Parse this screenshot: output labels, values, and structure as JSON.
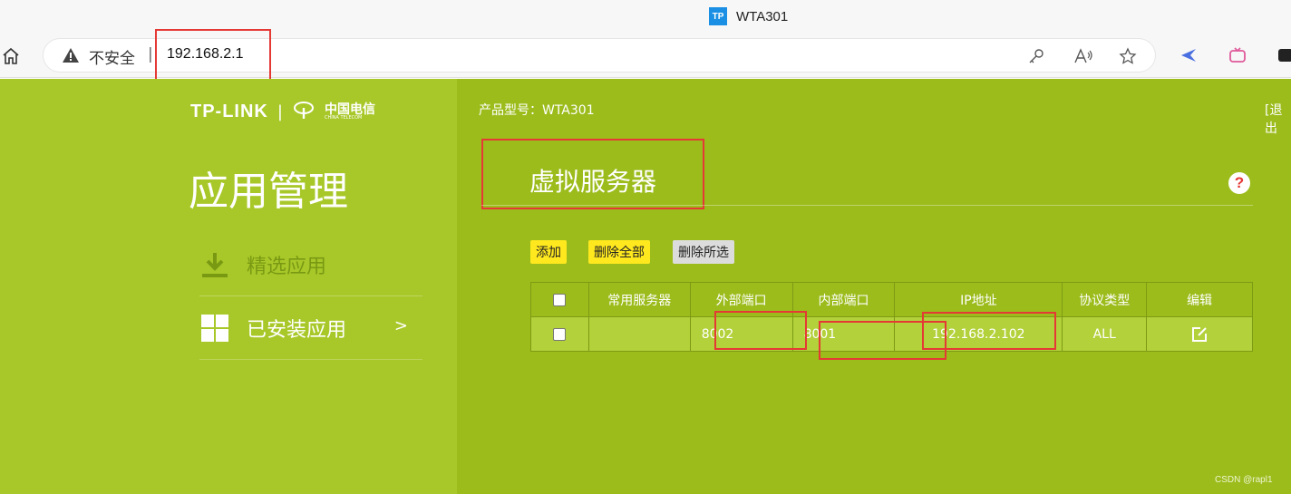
{
  "browser": {
    "tab_title": "WTA301",
    "favicon_text": "TP",
    "security_label": "不安全",
    "separator": "|",
    "url": "192.168.2.1"
  },
  "router": {
    "logo_brand": "TP-LINK",
    "logo_divider": "|",
    "logo_partner_cn": "中国电信",
    "logo_partner_en": "CHINA TELECOM",
    "model_label": "产品型号：WTA301",
    "logout_label": "[退出",
    "sidebar_title": "应用管理",
    "nav": [
      {
        "label": "精选应用",
        "icon": "download-icon"
      },
      {
        "label": "已安装应用",
        "icon": "grid-icon",
        "arrow": ">"
      }
    ],
    "section_title": "虚拟服务器",
    "help_label": "?",
    "buttons": {
      "add": "添加",
      "delete_all": "删除全部",
      "delete_selected": "删除所选"
    },
    "table": {
      "headers": [
        "",
        "常用服务器",
        "外部端口",
        "内部端口",
        "IP地址",
        "协议类型",
        "编辑"
      ],
      "rows": [
        {
          "checked": false,
          "common_server": "",
          "external_port": "8002",
          "internal_port": "8001",
          "ip": "192.168.2.102",
          "protocol": "ALL",
          "edit_icon": "edit-icon"
        }
      ]
    },
    "colors": {
      "page_bg": "#9cbc1c",
      "sidebar_bg": "#a8c829",
      "highlight": "#e53935",
      "button_yellow": "#ffe81e"
    }
  },
  "watermark": "CSDN @rapl1"
}
